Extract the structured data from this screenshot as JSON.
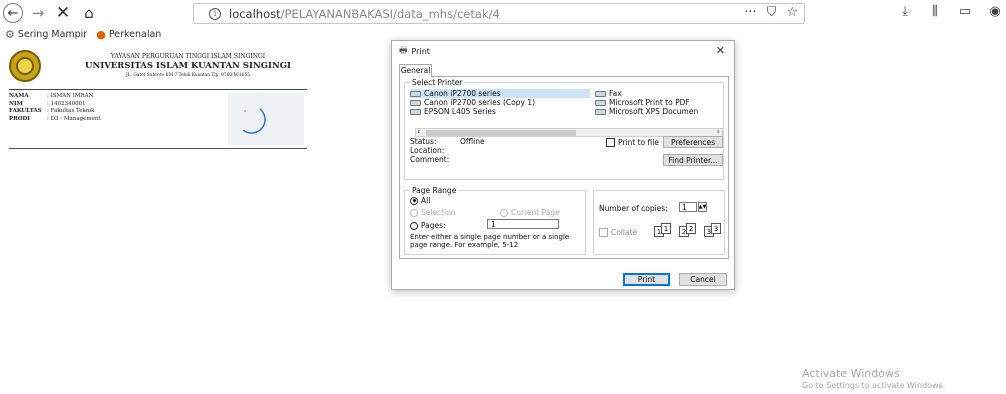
{
  "browser": {
    "url_host": "localhost",
    "url_path": "/PELAYANANBAKASI/data_mhs/cetak/4",
    "bookmarks": [
      {
        "label": "Sering Mampir",
        "icon": "gear-icon"
      },
      {
        "label": "Perkenalan",
        "icon": "firefox-icon"
      }
    ]
  },
  "document": {
    "foundation": "YAYASAN PERGURUAN TINGGI ISLAM SINGINGI",
    "university": "UNIVERSITAS ISLAM KUANTAN SINGINGI",
    "address": "JL. Gatot Subroto KM 7 Teluk Kuantan Tlp. 0760-561655",
    "student": [
      {
        "key": "NAMA",
        "value": ": ISMAN IMRAN"
      },
      {
        "key": "NIM",
        "value": ": 1402340001"
      },
      {
        "key": "FAKULTAS",
        "value": ": Fakultas Teknik"
      },
      {
        "key": "PRODI",
        "value": ": D3 - Management"
      }
    ]
  },
  "print_dialog": {
    "title": "Print",
    "tab": "General",
    "select_printer_label": "Select Printer",
    "printers": [
      {
        "name": "Canon iP2700 series",
        "selected": true
      },
      {
        "name": "Canon iP2700 series (Copy 1)",
        "selected": false
      },
      {
        "name": "EPSON L405 Series",
        "selected": false
      },
      {
        "name": "Fax",
        "selected": false
      },
      {
        "name": "Microsoft Print to PDF",
        "selected": false
      },
      {
        "name": "Microsoft XPS Documen",
        "selected": false
      }
    ],
    "status_label": "Status:",
    "status_value": "Offline",
    "location_label": "Location:",
    "comment_label": "Comment:",
    "print_to_file": "Print to file",
    "preferences": "Preferences",
    "find_printer": "Find Printer...",
    "page_range_label": "Page Range",
    "range_all": "All",
    "range_selection": "Selection",
    "range_current": "Current Page",
    "range_pages": "Pages:",
    "pages_value": "1",
    "range_hint": "Enter either a single page number or a single page range.  For example, 5-12",
    "copies_label": "Number of copies:",
    "copies_value": "1",
    "collate": "Collate",
    "print_button": "Print",
    "cancel_button": "Cancel"
  },
  "watermark": {
    "title": "Activate Windows",
    "subtitle": "Go to Settings to activate Windows."
  }
}
